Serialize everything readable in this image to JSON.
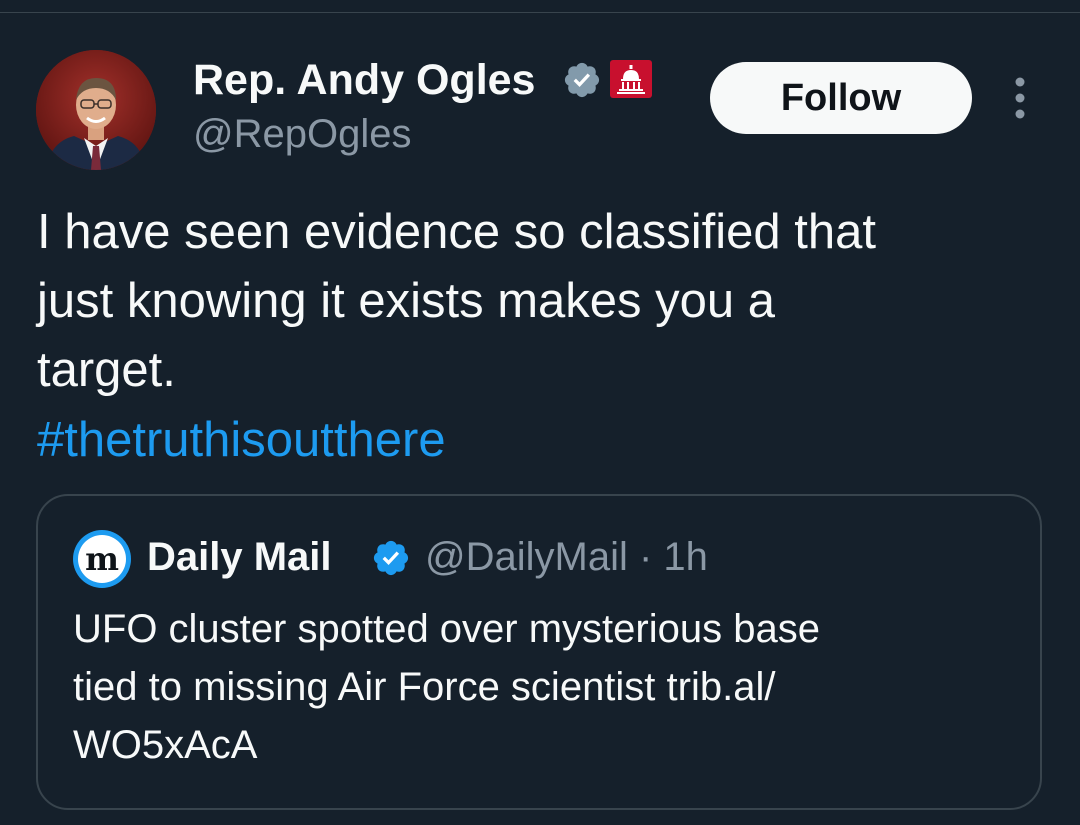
{
  "tweet": {
    "author_name": "Rep. Andy Ogles",
    "author_handle": "@RepOgles",
    "follow_label": "Follow",
    "text_lines": [
      "I have seen evidence so classified that",
      "just knowing it exists makes you a",
      "target."
    ],
    "hashtag": "#thetruthisoutthere"
  },
  "quote": {
    "logo_letter": "m",
    "author_name": "Daily Mail",
    "handle_time": "@DailyMail · 1h",
    "text_lines": [
      "UFO cluster spotted over mysterious base",
      "tied to missing Air Force scientist trib.al/",
      "WO5xAcA"
    ]
  },
  "icons": {
    "author_badge": "verified-gray-icon",
    "affiliation_badge": "capitol-badge-icon",
    "more": "more-vertical-icon",
    "quote_badge": "verified-blue-icon"
  },
  "colors": {
    "background": "#15202b",
    "text": "#f7f9f9",
    "secondary_text": "#8b98a5",
    "link": "#1d9bf0",
    "border": "#38444d",
    "gov_badge": "#c8102e",
    "verified_gray": "#829aab",
    "verified_blue": "#1d9bf0"
  }
}
